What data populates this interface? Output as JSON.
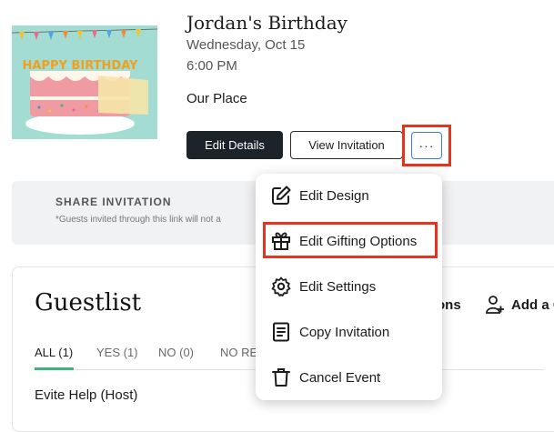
{
  "event": {
    "title": "Jordan's Birthday",
    "date": "Wednesday, Oct 15",
    "time": "6:00 PM",
    "venue": "Our Place",
    "thumbnail_text": "HAPPY BIRTHDAY"
  },
  "actions": {
    "edit_details": "Edit Details",
    "view_invitation": "View Invitation",
    "more": "···"
  },
  "share": {
    "title": "SHARE INVITATION",
    "note": "*Guests invited through this link will not a"
  },
  "guestlist": {
    "title": "Guestlist",
    "action_partial": "ons",
    "add_label": "Add a G",
    "tabs": [
      {
        "label": "ALL (1)",
        "active": true
      },
      {
        "label": "YES (1)",
        "active": false
      },
      {
        "label": "NO (0)",
        "active": false
      },
      {
        "label": "NO RE",
        "active": false
      }
    ],
    "rows": [
      "Evite Help (Host)"
    ]
  },
  "menu": {
    "items": [
      {
        "label": "Edit Design",
        "icon": "pencil-square-icon"
      },
      {
        "label": "Edit Gifting Options",
        "icon": "gift-icon"
      },
      {
        "label": "Edit Settings",
        "icon": "gear-icon"
      },
      {
        "label": "Copy Invitation",
        "icon": "document-icon"
      },
      {
        "label": "Cancel Event",
        "icon": "trash-icon"
      }
    ]
  },
  "colors": {
    "highlight": "#e4331e",
    "primary_button": "#1c2329",
    "tab_active": "#3fb27f",
    "focus_border": "#3f7ddd"
  }
}
